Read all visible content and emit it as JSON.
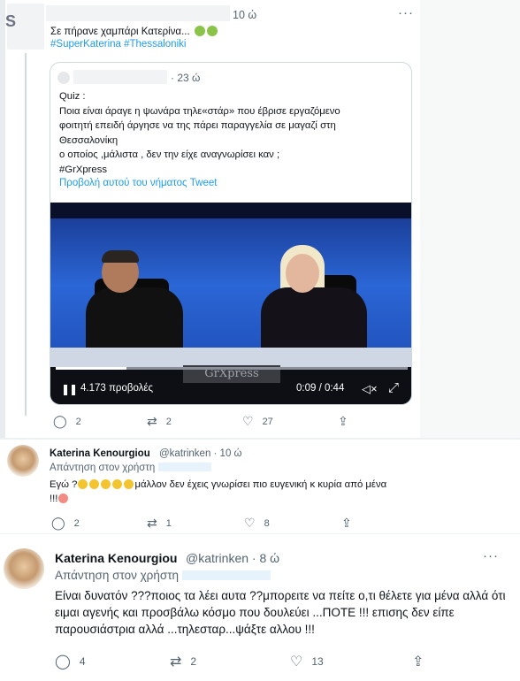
{
  "tweet": {
    "time": "10 ώ",
    "text": "Σε πήρανε χαμπάρι Κατερίνα...",
    "hashtags": "#SuperKaterina #Thessaloniki",
    "actions": {
      "replies": "2",
      "retweets": "2",
      "likes": "27"
    }
  },
  "quoted": {
    "time": "· 23 ώ",
    "text": "Quiz :\nΠοια είναι άραγε η ψωνάρα τηλε«στάρ» που έβρισε εργαζόμενο\nφοιτητή επειδή άργησε να της πάρει παραγγελία σε μαγαζί στη\nΘεσσαλονίκη\nο οποίος ,μάλιστα , δεν την είχε αναγνωρίσει καν  ;\n#GrXpress",
    "link": "Προβολή αυτού του νήματος Tweet",
    "video": {
      "views": "4.173 προβολές",
      "time": "0:09 / 0:44",
      "progress": 0.2,
      "watermark": "GrXpress"
    }
  },
  "reply1": {
    "name": "Katerina Kenourgiou",
    "handle": "@katrinken · 10 ώ",
    "replying": "Απάντηση στον χρήστη",
    "text_a": "Εγώ ?",
    "text_b": "μάλλον δεν έχεις γνωρίσει πιο ευγενική κ κυρία από μένα",
    "text_c": "!!!",
    "actions": {
      "replies": "2",
      "retweets": "1",
      "likes": "8"
    }
  },
  "reply2": {
    "name": "Katerina Kenourgiou",
    "handle": "@katrinken · 8 ώ",
    "replying": "Απάντηση στον χρήστη",
    "text": "Είναι δυνατόν ???ποιος τα λέει αυτα ??μπορειτε να πείτε ο,τι θέλετε για μένα αλλά ότι ειμαι αγενής και προσβάλω κόσμο που δουλεύει ...ΠΟΤΕ !!! επισης δεν είπε παρουσιάστρια αλλά ...τηλεσταρ...ψάξτε αλλου !!!",
    "actions": {
      "replies": "4",
      "retweets": "2",
      "likes": "13"
    }
  },
  "icons": {
    "more": "···",
    "reply": "◯",
    "retweet": "⇄",
    "like": "♡",
    "share": "⇪",
    "play": "❚❚",
    "volume": "◁×",
    "fullscreen": "⤢"
  },
  "colors": {
    "link": "#1d9bf0",
    "muted": "#536471"
  }
}
